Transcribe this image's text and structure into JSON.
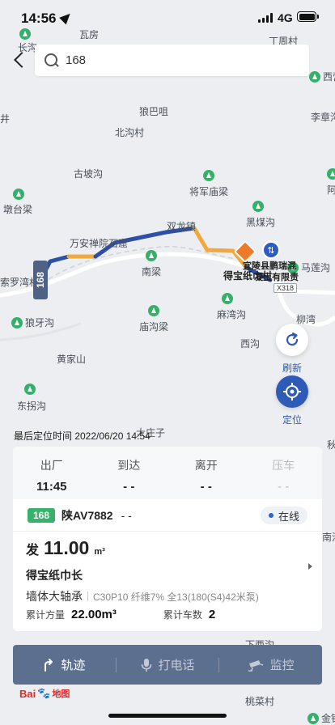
{
  "status_bar": {
    "time": "14:56",
    "network": "4G"
  },
  "search": {
    "query": "168"
  },
  "map": {
    "places": [
      {
        "name": "长沟",
        "tree": true
      },
      {
        "name": "瓦房",
        "tree": false
      },
      {
        "name": "丁周村",
        "tree": false
      },
      {
        "name": "西营",
        "tree": true
      },
      {
        "name": "李章沟",
        "tree": false
      },
      {
        "name": "狼巴咀",
        "tree": false
      },
      {
        "name": "北沟村",
        "tree": false
      },
      {
        "name": "古坡沟",
        "tree": false
      },
      {
        "name": "将军庙梁",
        "tree": true
      },
      {
        "name": "墩台梁",
        "tree": true
      },
      {
        "name": "黑煤沟",
        "tree": true
      },
      {
        "name": "双龙镇",
        "tree": false
      },
      {
        "name": "万安禅院石窟",
        "tree": false
      },
      {
        "name": "南梁",
        "tree": true
      },
      {
        "name": "马莲沟",
        "tree": true
      },
      {
        "name": "宜陵县鹏瑞混",
        "tree": false
      },
      {
        "name": "得宝纸巾村",
        "tree": false
      },
      {
        "name": "凝土有限责",
        "tree": false
      },
      {
        "name": "索罗湾村",
        "tree": false
      },
      {
        "name": "狼牙沟",
        "tree": true
      },
      {
        "name": "庙沟梁",
        "tree": true
      },
      {
        "name": "麻湾沟",
        "tree": true
      },
      {
        "name": "柳湾",
        "tree": false
      },
      {
        "name": "西沟",
        "tree": false
      },
      {
        "name": "黄家山",
        "tree": false
      },
      {
        "name": "东拐沟",
        "tree": true
      },
      {
        "name": "大庄子",
        "tree": false
      },
      {
        "name": "秋",
        "tree": false
      },
      {
        "name": "南沟",
        "tree": false
      },
      {
        "name": "下西沟",
        "tree": false
      },
      {
        "name": "桃菜村",
        "tree": false
      },
      {
        "name": "金钱",
        "tree": true
      },
      {
        "name": "阿",
        "tree": true
      },
      {
        "name": "井",
        "tree": false
      }
    ],
    "road_label": "X318",
    "vehicle_marker_label": "168",
    "refresh_label": "刷新",
    "locate_label": "定位"
  },
  "fix_time": "最后定位时间 2022/06/20 14:54",
  "stages": [
    {
      "label": "出厂",
      "value": "11:45",
      "active": true
    },
    {
      "label": "到达",
      "value": "- -",
      "active": true
    },
    {
      "label": "离开",
      "value": "- -",
      "active": true
    },
    {
      "label": "压车",
      "value": "- -",
      "active": false
    }
  ],
  "vehicle": {
    "badge": "168",
    "plate": "陕AV7882",
    "driver": "- -",
    "status": "在线"
  },
  "order": {
    "prefix": "发",
    "volume": "11.00",
    "unit": "m³",
    "site": "得宝纸巾长",
    "part": "墙体大轴承",
    "mix": "C30P10 纤维7% 全13(180(S4)42米泵)",
    "total_volume_label": "累计方量",
    "total_volume": "22.00m³",
    "total_trips_label": "累计车数",
    "total_trips": "2"
  },
  "actions": [
    {
      "label": "轨迹",
      "icon": "track-icon",
      "enabled": true
    },
    {
      "label": "打电话",
      "icon": "microphone-icon",
      "enabled": false
    },
    {
      "label": "监控",
      "icon": "camera-icon",
      "enabled": false
    }
  ],
  "logo": {
    "text": "Bai",
    "sub": "地图"
  },
  "colors": {
    "route_blue": "#2d4fa8",
    "route_orange": "#f2a93b",
    "accent": "#2e5bb8",
    "online_dot": "#2d64c8",
    "badge_green": "#37b26b"
  }
}
